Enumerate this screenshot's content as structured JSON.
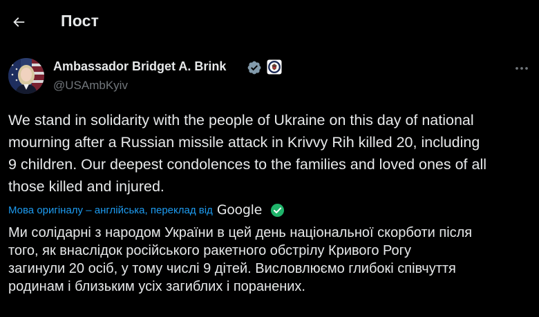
{
  "header": {
    "back_icon": "arrow-left-icon",
    "title": "Пост"
  },
  "author": {
    "name": "Ambassador Bridget A. Brink",
    "handle": "@USAmbKyiv",
    "verified_icon": "verified-badge-icon",
    "affiliation_icon": "us-state-department-seal-icon",
    "more_icon": "more-horizontal-icon"
  },
  "post": {
    "lines": [
      "We stand in solidarity with the people of Ukraine on this day of national",
      "mourning after a Russian missile attack in Krivvy Rih killed 20, including",
      "9 children. Our deepest condolences to the families and loved ones of all",
      "those killed and injured."
    ]
  },
  "translation": {
    "note": "Мова оригіналу – англійська, переклад від",
    "provider": "Google",
    "lines": [
      "Ми солідарні з народом України в цей день національної скорботи після",
      "того, як внаслідок російського ракетного обстрілу Кривого Рогу",
      "загинули 20 осіб, у тому числі 9 дітей. Висловлюємо глибокі співчуття",
      "родинам і близьким усіх загиблих і поранених."
    ]
  },
  "colors": {
    "background": "#000000",
    "text": "#e7e9ea",
    "secondary": "#71767b",
    "link": "#1d9bf0",
    "verified": "#829aab",
    "check": "#1fb36a"
  }
}
